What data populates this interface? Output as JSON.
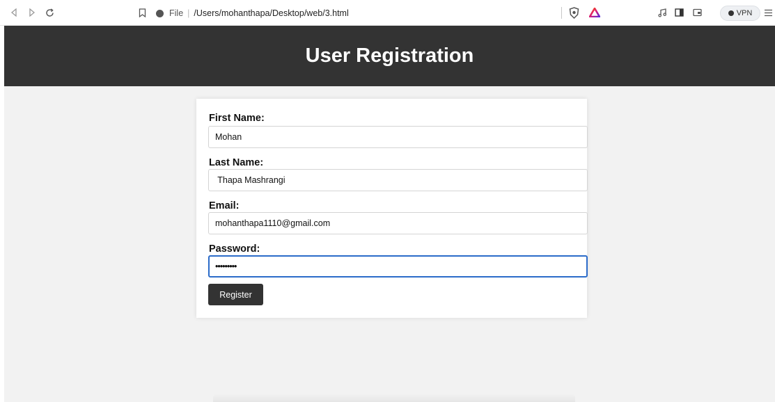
{
  "browser": {
    "address_scheme": "File",
    "address_url": "/Users/mohanthapa/Desktop/web/3.html",
    "vpn_label": "VPN",
    "icons": {
      "back": "back-arrow-icon",
      "forward": "forward-arrow-icon",
      "reload": "reload-icon",
      "bookmark": "bookmark-icon",
      "info": "info-icon",
      "shield": "brave-shield-icon",
      "rewards": "brave-rewards-icon",
      "media": "music-note-icon",
      "sidebar": "sidebar-icon",
      "wallet": "wallet-icon",
      "menu": "hamburger-menu-icon"
    }
  },
  "page": {
    "title": "User Registration",
    "form": {
      "first_name_label": "First Name:",
      "first_name_value": "Mohan",
      "last_name_label": "Last Name:",
      "last_name_value": " Thapa Mashrangi",
      "email_label": "Email:",
      "email_value": "mohanthapa1110@gmail.com",
      "password_label": "Password:",
      "password_value": "•••••••••",
      "submit_label": "Register"
    }
  },
  "colors": {
    "header_bg": "#333333",
    "page_bg": "#f2f2f2",
    "focus_border": "#2b6bc9",
    "button_bg": "#333333"
  }
}
